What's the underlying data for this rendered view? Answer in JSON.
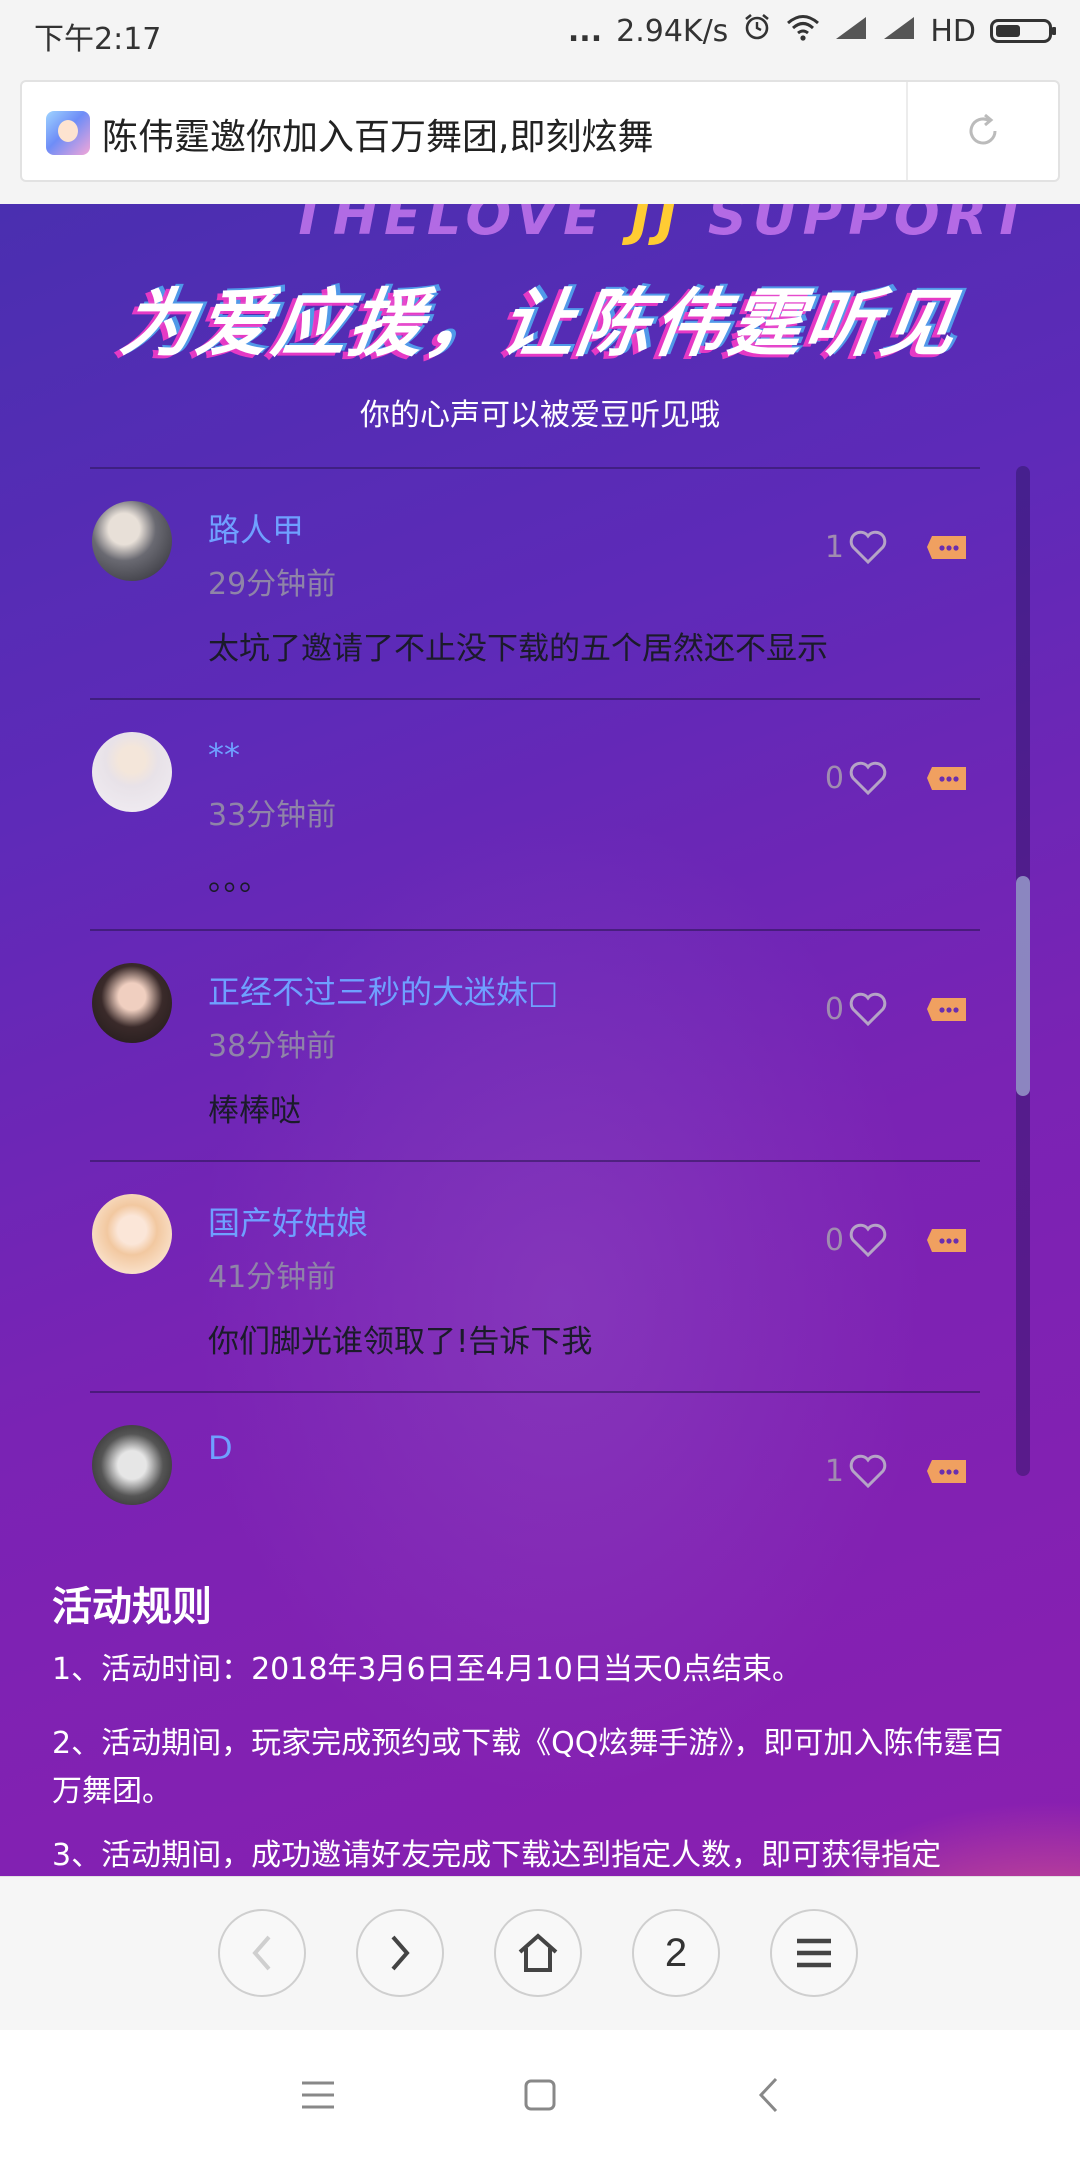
{
  "status_bar": {
    "time": "下午2:17",
    "dots": "...",
    "speed": "2.94K/s",
    "network_label": "HD"
  },
  "address_bar": {
    "title": "陈伟霆邀你加入百万舞团,即刻炫舞"
  },
  "hero": {
    "deco_left": "THELOVE",
    "deco_mid": "JJ",
    "deco_right": "SUPPORT",
    "title": "为爱应援，让陈伟霆听见",
    "subtitle": "你的心声可以被爱豆听见哦"
  },
  "comments": [
    {
      "username": "路人甲",
      "time": "29分钟前",
      "text": "太坑了邀请了不止没下载的五个居然还不显示",
      "likes": "1"
    },
    {
      "username": "**",
      "time": "33分钟前",
      "text": "。。。",
      "likes": "0"
    },
    {
      "username": "正经不过三秒的大迷妹□",
      "time": "38分钟前",
      "text": "棒棒哒",
      "likes": "0"
    },
    {
      "username": "国产好姑娘",
      "time": "41分钟前",
      "text": "你们脚光谁领取了!告诉下我",
      "likes": "0"
    },
    {
      "username": "D",
      "time": "",
      "text": "",
      "likes": "1"
    }
  ],
  "rules": {
    "title": "活动规则",
    "items": [
      "1、活动时间：2018年3月6日至4月10日当天0点结束。",
      "2、活动期间，玩家完成预约或下载《QQ炫舞手游》，即可加入陈伟霆百万舞团。",
      "3、活动期间，成功邀请好友完成下载达到指定人数，即可获得指定"
    ]
  },
  "toolbar": {
    "tab_count": "2"
  },
  "colors": {
    "username": "#6fa0ff",
    "content_gradient_start": "#4a2fb0",
    "content_gradient_end": "#8a1fb0",
    "accent_pink": "#ff6e78"
  },
  "icons": [
    "alarm-icon",
    "wifi-icon",
    "signal-icon",
    "battery-icon",
    "reload-icon",
    "heart-icon",
    "message-icon",
    "back-icon",
    "forward-icon",
    "home-icon",
    "menu-icon",
    "recents-icon",
    "home-nav-icon",
    "back-nav-icon"
  ]
}
